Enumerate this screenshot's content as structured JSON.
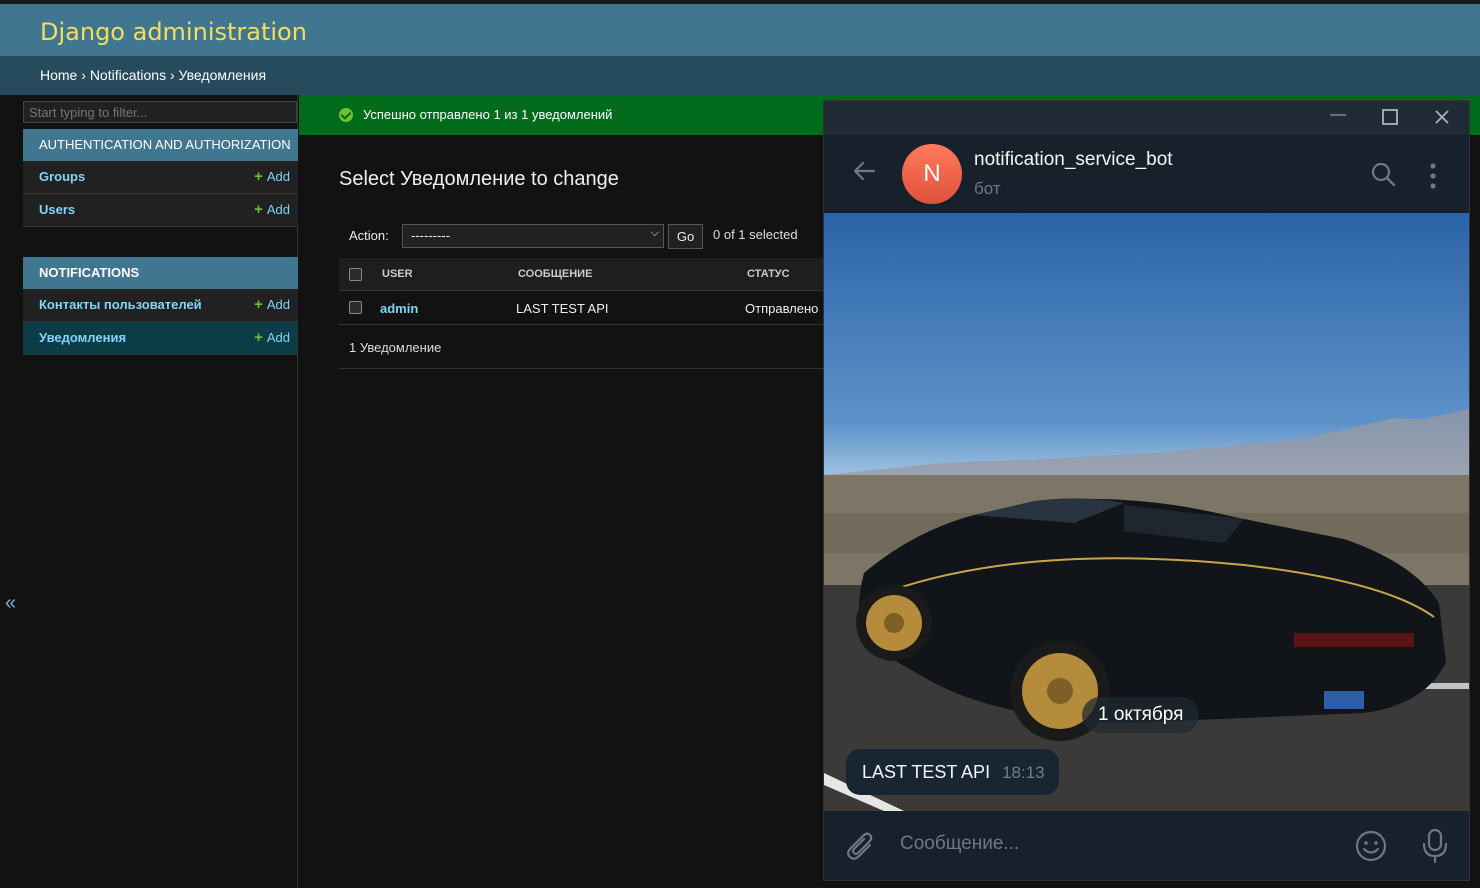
{
  "header": {
    "brand": "Django administration"
  },
  "breadcrumbs": {
    "home": "Home",
    "sep1": " › ",
    "app": "Notifications",
    "sep2": " › ",
    "current": "Уведомления"
  },
  "sidebar": {
    "filter_placeholder": "Start typing to filter...",
    "apps": [
      {
        "caption": "Authentication and Authorization",
        "models": [
          {
            "name": "Groups",
            "add": "Add"
          },
          {
            "name": "Users",
            "add": "Add"
          }
        ]
      },
      {
        "caption": "Notifications",
        "models": [
          {
            "name": "Контакты пользователей",
            "add": "Add"
          },
          {
            "name": "Уведомления",
            "add": "Add"
          }
        ]
      }
    ],
    "collapse_glyph": "«"
  },
  "messages": {
    "success": "Успешно отправлено 1 из 1 уведомлений"
  },
  "content": {
    "title": "Select Уведомление to change",
    "action_label": "Action:",
    "action_value": "---------",
    "go_label": "Go",
    "selected_count": "0 of 1 selected",
    "columns": [
      "User",
      "Сообщение",
      "Статус"
    ],
    "rows": [
      {
        "user": "admin",
        "message": "LAST TEST API",
        "status": "Отправлено"
      }
    ],
    "paginator": "1 Уведомление"
  },
  "telegram": {
    "bot_name": "notification_service_bot",
    "bot_status": "бот",
    "avatar_letter": "N",
    "date_label": "1 октября",
    "message_text": "LAST TEST API",
    "message_time": "18:13",
    "input_placeholder": "Сообщение..."
  },
  "colors": {
    "header_bg": "#417690",
    "brand": "#f5dd5d",
    "breadcrumb_bg": "#264b5d",
    "success_bg": "#006b1b",
    "link": "#81d4fa",
    "add_plus": "#70bf2b",
    "telegram_bg": "#17212b"
  }
}
